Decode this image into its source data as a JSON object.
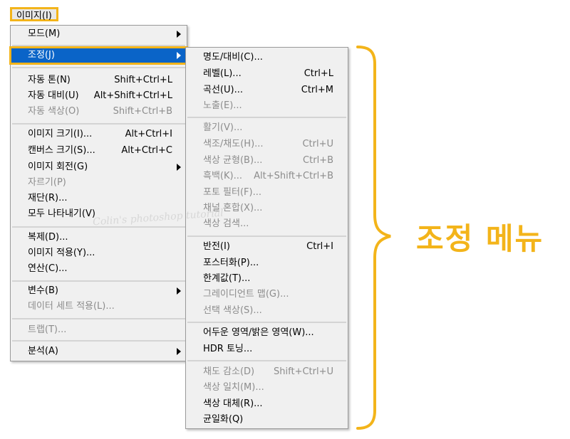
{
  "menubar": {
    "image_menu_label": "이미지(I)"
  },
  "main_menu": {
    "mode": "모드(M)",
    "adjustments": "조정(J)",
    "auto_tone": "자동 톤(N)",
    "auto_tone_sc": "Shift+Ctrl+L",
    "auto_contrast": "자동 대비(U)",
    "auto_contrast_sc": "Alt+Shift+Ctrl+L",
    "auto_color": "자동 색상(O)",
    "auto_color_sc": "Shift+Ctrl+B",
    "image_size": "이미지 크기(I)...",
    "image_size_sc": "Alt+Ctrl+I",
    "canvas_size": "캔버스 크기(S)...",
    "canvas_size_sc": "Alt+Ctrl+C",
    "image_rotation": "이미지 회전(G)",
    "crop": "자르기(P)",
    "trim": "재단(R)...",
    "reveal_all": "모두 나타내기(V)",
    "duplicate": "복제(D)...",
    "apply_image": "이미지 적용(Y)...",
    "calculations": "연산(C)...",
    "variables": "변수(B)",
    "data_sets": "데이터 세트 적용(L)...",
    "trap": "트랩(T)...",
    "analysis": "분석(A)"
  },
  "sub_menu": {
    "brightness_contrast": "명도/대비(C)...",
    "levels": "레벨(L)...",
    "levels_sc": "Ctrl+L",
    "curves": "곡선(U)...",
    "curves_sc": "Ctrl+M",
    "exposure": "노출(E)...",
    "vibrance": "활기(V)...",
    "hue_saturation": "색조/채도(H)...",
    "hue_saturation_sc": "Ctrl+U",
    "color_balance": "색상 균형(B)...",
    "color_balance_sc": "Ctrl+B",
    "black_white": "흑백(K)...",
    "black_white_sc": "Alt+Shift+Ctrl+B",
    "photo_filter": "포토 필터(F)...",
    "channel_mixer": "채널 혼합(X)...",
    "color_lookup": "색상 검색...",
    "invert": "반전(I)",
    "invert_sc": "Ctrl+I",
    "posterize": "포스터화(P)...",
    "threshold": "한계값(T)...",
    "gradient_map": "그레이디언트 맵(G)...",
    "selective_color": "선택 색상(S)...",
    "shadows_highlights": "어두운 영역/밝은 영역(W)...",
    "hdr_toning": "HDR 토닝...",
    "desaturate": "채도 감소(D)",
    "desaturate_sc": "Shift+Ctrl+U",
    "match_color": "색상 일치(M)...",
    "replace_color": "색상 대체(R)...",
    "equalize": "균일화(Q)"
  },
  "annotation": {
    "label": "조정 메뉴"
  },
  "watermark": "Colin's photoshop tutorial",
  "colors": {
    "accent": "#f3b41a",
    "highlight": "#0a64c8",
    "menu_bg": "#f0f0f0"
  }
}
